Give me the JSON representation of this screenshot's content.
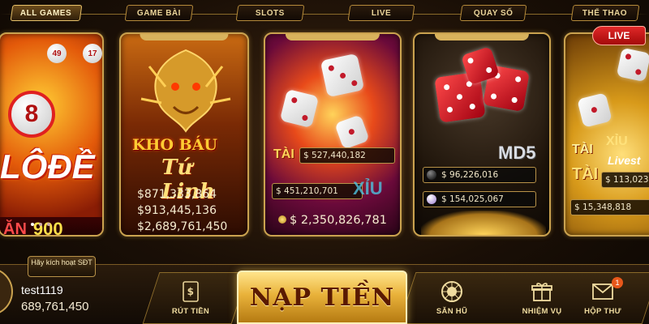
{
  "tabs": [
    {
      "label": "ALL GAMES",
      "active": true
    },
    {
      "label": "GAME BÀI",
      "active": false
    },
    {
      "label": "SLOTS",
      "active": false
    },
    {
      "label": "LIVE",
      "active": false
    },
    {
      "label": "QUAY SỐ",
      "active": false
    },
    {
      "label": "THỂ THAO",
      "active": false
    }
  ],
  "cards": {
    "lode": {
      "title": "LÔĐỀ",
      "ball_number": "8",
      "ball_small_1": "49",
      "ball_small_2": "17",
      "payout_prefix": "ĂN",
      "payout_value": "900"
    },
    "kho_bau": {
      "title_line1": "KHO BÁU",
      "title_line2": "Tứ Linh",
      "jackpots": [
        "$871,333,864",
        "$913,445,136",
        "$2,689,761,450"
      ]
    },
    "tai_xiu": {
      "tai_label": "TÀI",
      "xiu_label": "XỈU",
      "jackpot_1": "$ 527,440,182",
      "jackpot_2": "$ 451,210,701",
      "jackpot_3": "$ 2,350,826,781"
    },
    "md5": {
      "title": "MD5",
      "jackpot_1": "$ 96,226,016",
      "jackpot_2": "$ 154,025,067"
    },
    "live": {
      "badge": "LIVE",
      "tai_label": "TÀI",
      "xiu_label": "XỈU",
      "sub_label": "Livest",
      "jackpot_1": "$ 113,023,",
      "jackpot_2": "$ 15,348,818"
    }
  },
  "user": {
    "activate_prompt": "Hãy kích hoạt SĐT",
    "username": "test1119",
    "balance": "689,761,450"
  },
  "bottom_nav": {
    "withdraw_label": "RÚT TIỀN",
    "deposit_label": "NẠP TIỀN",
    "jackpot_hunt_label": "SĂN HŨ",
    "missions_label": "NHIỆM VỤ",
    "mailbox_label": "HỘP THƯ",
    "mailbox_badge": "1"
  },
  "colors": {
    "gold_border": "#caa24f",
    "accent_red": "#e02828",
    "deposit_gold": "#e9b23a"
  }
}
